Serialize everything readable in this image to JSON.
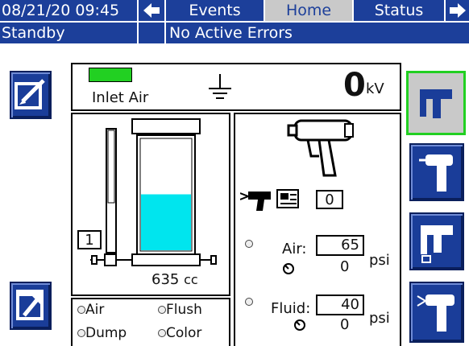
{
  "header": {
    "datetime": "08/21/20 09:45",
    "tabs": {
      "events": "Events",
      "home": "Home",
      "status": "Status"
    },
    "mode": "Standby",
    "errors": "No Active Errors"
  },
  "top": {
    "inlet_air_label": "Inlet Air",
    "inlet_air_color": "#22d022",
    "voltage_value": "0",
    "voltage_unit": "kV"
  },
  "reservoir": {
    "index": "1",
    "volume_value": "635",
    "volume_unit": "cc",
    "fill_level": 0.5,
    "fill_color": "#00e5ee"
  },
  "valves": {
    "air": "Air",
    "flush": "Flush",
    "dump": "Dump",
    "color": "Color"
  },
  "gun": {
    "count": "0",
    "air_label": "Air:",
    "air_setpoint": "65",
    "air_actual": "0",
    "fluid_label": "Fluid:",
    "fluid_setpoint": "40",
    "fluid_actual": "0",
    "unit": "psi"
  },
  "colors": {
    "accent_blue": "#1a3d99",
    "selected_green": "#22d022"
  }
}
